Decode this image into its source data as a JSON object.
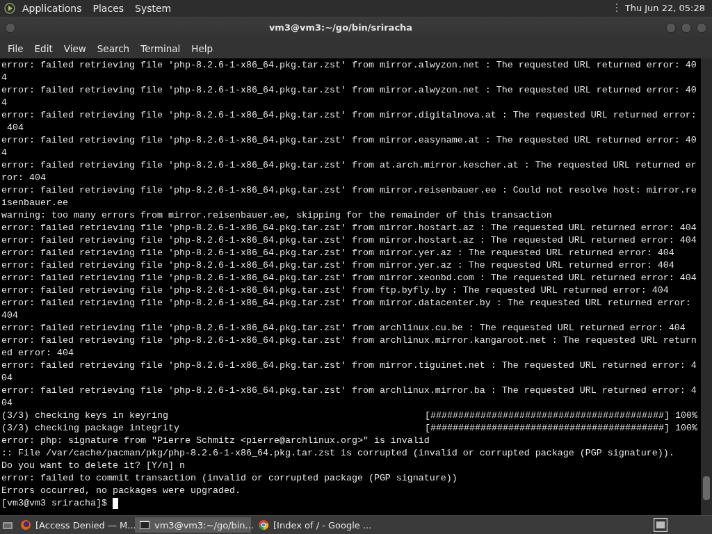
{
  "top_panel": {
    "menus": [
      "Applications",
      "Places",
      "System"
    ],
    "clock": "Thu Jun 22, 05:28"
  },
  "window": {
    "title": "vm3@vm3:~/go/bin/sriracha"
  },
  "menu_bar": [
    "File",
    "Edit",
    "View",
    "Search",
    "Terminal",
    "Help"
  ],
  "terminal": {
    "lines": [
      {
        "kind": "text",
        "text": "error: failed retrieving file 'php-8.2.6-1-x86_64.pkg.tar.zst' from mirror.alwyzon.net : The requested URL returned error: 40"
      },
      {
        "kind": "text",
        "text": "4"
      },
      {
        "kind": "text",
        "text": "error: failed retrieving file 'php-8.2.6-1-x86_64.pkg.tar.zst' from mirror.alwyzon.net : The requested URL returned error: 40"
      },
      {
        "kind": "text",
        "text": "4"
      },
      {
        "kind": "text",
        "text": "error: failed retrieving file 'php-8.2.6-1-x86_64.pkg.tar.zst' from mirror.digitalnova.at : The requested URL returned error:"
      },
      {
        "kind": "text",
        "text": " 404"
      },
      {
        "kind": "text",
        "text": "error: failed retrieving file 'php-8.2.6-1-x86_64.pkg.tar.zst' from mirror.easyname.at : The requested URL returned error: 40"
      },
      {
        "kind": "text",
        "text": "4"
      },
      {
        "kind": "text",
        "text": "error: failed retrieving file 'php-8.2.6-1-x86_64.pkg.tar.zst' from at.arch.mirror.kescher.at : The requested URL returned er"
      },
      {
        "kind": "text",
        "text": "ror: 404"
      },
      {
        "kind": "text",
        "text": "error: failed retrieving file 'php-8.2.6-1-x86_64.pkg.tar.zst' from mirror.reisenbauer.ee : Could not resolve host: mirror.re"
      },
      {
        "kind": "text",
        "text": "isenbauer.ee"
      },
      {
        "kind": "text",
        "text": "warning: too many errors from mirror.reisenbauer.ee, skipping for the remainder of this transaction"
      },
      {
        "kind": "text",
        "text": "error: failed retrieving file 'php-8.2.6-1-x86_64.pkg.tar.zst' from mirror.hostart.az : The requested URL returned error: 404"
      },
      {
        "kind": "text",
        "text": "error: failed retrieving file 'php-8.2.6-1-x86_64.pkg.tar.zst' from mirror.hostart.az : The requested URL returned error: 404"
      },
      {
        "kind": "text",
        "text": "error: failed retrieving file 'php-8.2.6-1-x86_64.pkg.tar.zst' from mirror.yer.az : The requested URL returned error: 404"
      },
      {
        "kind": "text",
        "text": "error: failed retrieving file 'php-8.2.6-1-x86_64.pkg.tar.zst' from mirror.yer.az : The requested URL returned error: 404"
      },
      {
        "kind": "text",
        "text": "error: failed retrieving file 'php-8.2.6-1-x86_64.pkg.tar.zst' from mirror.xeonbd.com : The requested URL returned error: 404"
      },
      {
        "kind": "text",
        "text": "error: failed retrieving file 'php-8.2.6-1-x86_64.pkg.tar.zst' from ftp.byfly.by : The requested URL returned error: 404"
      },
      {
        "kind": "text",
        "text": "error: failed retrieving file 'php-8.2.6-1-x86_64.pkg.tar.zst' from mirror.datacenter.by : The requested URL returned error:"
      },
      {
        "kind": "text",
        "text": "404"
      },
      {
        "kind": "text",
        "text": "error: failed retrieving file 'php-8.2.6-1-x86_64.pkg.tar.zst' from archlinux.cu.be : The requested URL returned error: 404"
      },
      {
        "kind": "text",
        "text": "error: failed retrieving file 'php-8.2.6-1-x86_64.pkg.tar.zst' from archlinux.mirror.kangaroot.net : The requested URL return"
      },
      {
        "kind": "text",
        "text": "ed error: 404"
      },
      {
        "kind": "text",
        "text": "error: failed retrieving file 'php-8.2.6-1-x86_64.pkg.tar.zst' from mirror.tiguinet.net : The requested URL returned error: 4"
      },
      {
        "kind": "text",
        "text": "04"
      },
      {
        "kind": "text",
        "text": "error: failed retrieving file 'php-8.2.6-1-x86_64.pkg.tar.zst' from archlinux.mirror.ba : The requested URL returned error: 4"
      },
      {
        "kind": "text",
        "text": "04"
      },
      {
        "kind": "progress",
        "text": "(3/3) checking keys in keyring",
        "bar": "[##########################################]",
        "percent": "100%"
      },
      {
        "kind": "progress",
        "text": "(3/3) checking package integrity",
        "bar": "[##########################################]",
        "percent": "100%"
      },
      {
        "kind": "text",
        "text": "error: php: signature from \"Pierre Schmitz <pierre@archlinux.org>\" is invalid"
      },
      {
        "kind": "text",
        "text": ":: File /var/cache/pacman/pkg/php-8.2.6-1-x86_64.pkg.tar.zst is corrupted (invalid or corrupted package (PGP signature))."
      },
      {
        "kind": "text",
        "text": "Do you want to delete it? [Y/n] n"
      },
      {
        "kind": "text",
        "text": "error: failed to commit transaction (invalid or corrupted package (PGP signature))"
      },
      {
        "kind": "text",
        "text": "Errors occurred, no packages were upgraded."
      }
    ],
    "prompt": "[vm3@vm3 sriracha]$"
  },
  "taskbar": {
    "items": [
      {
        "kind": "browser",
        "label": "[Access Denied — M...",
        "selected": false
      },
      {
        "kind": "terminal",
        "label": "vm3@vm3:~/go/bin...",
        "selected": true
      },
      {
        "kind": "chrome",
        "label": "[Index of / - Google ...",
        "selected": false
      }
    ]
  }
}
